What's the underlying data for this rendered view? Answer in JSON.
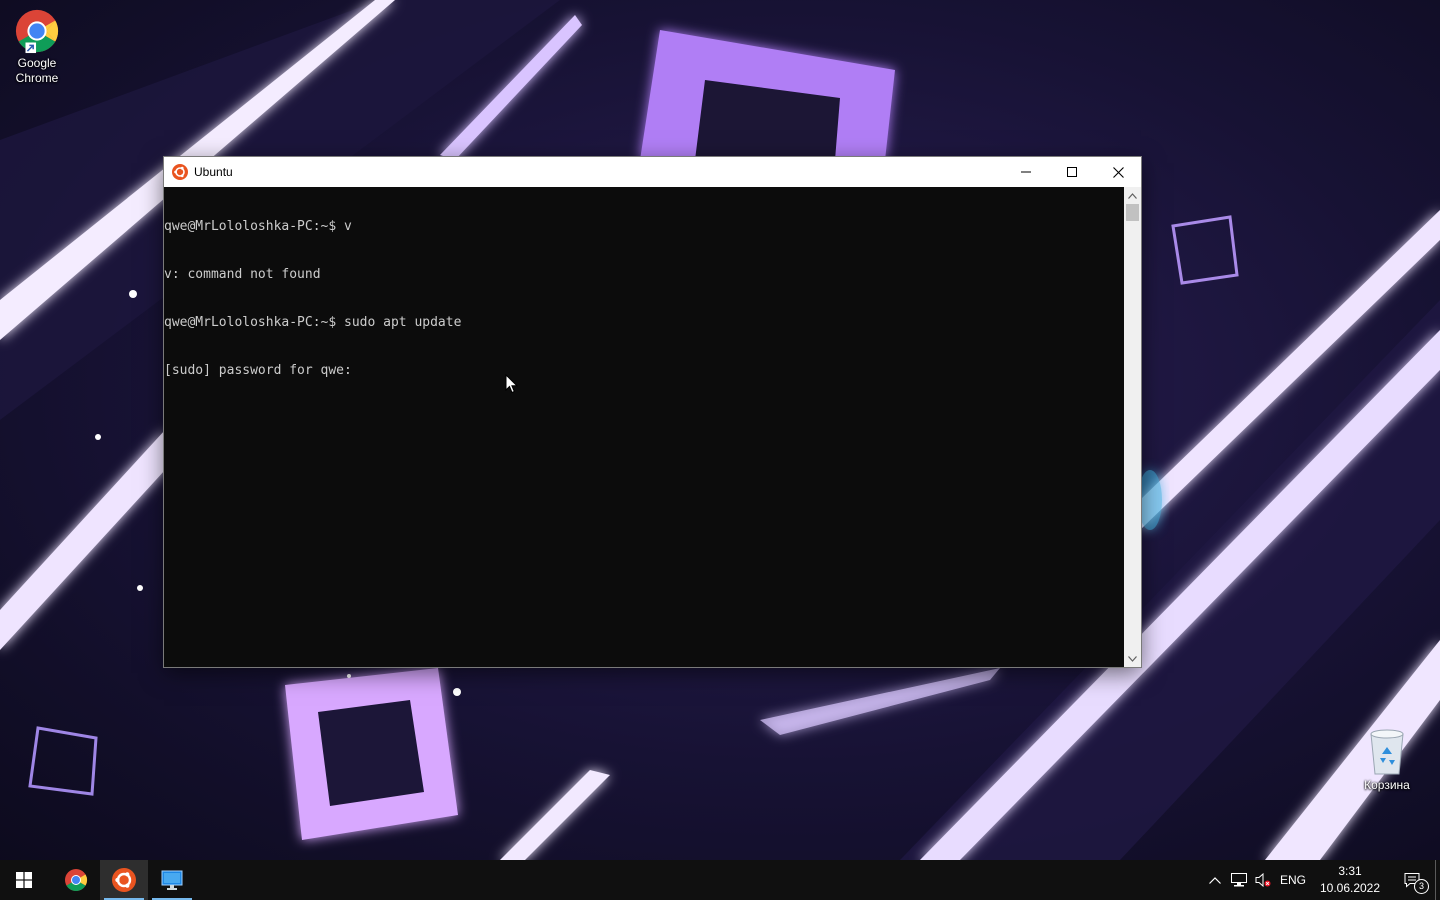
{
  "desktop": {
    "icons": [
      {
        "label": "Google Chrome",
        "icon": "chrome-icon"
      },
      {
        "label": "Корзина",
        "icon": "recycle-bin-icon"
      }
    ]
  },
  "window": {
    "title": "Ubuntu",
    "icon": "ubuntu-icon",
    "controls": [
      "minimize-icon",
      "maximize-icon",
      "close-icon"
    ],
    "console_lines": [
      "qwe@MrLololoshka-PC:~$ v",
      "v: command not found",
      "qwe@MrLololoshka-PC:~$ sudo apt update",
      "[sudo] password for qwe:"
    ],
    "background_color": "#0c0c0c",
    "text_color": "#cccccc"
  },
  "taskbar": {
    "pinned": [
      {
        "icon": "windows-start-icon",
        "active": false
      },
      {
        "icon": "chrome-icon",
        "active": false
      },
      {
        "icon": "ubuntu-icon",
        "active": true
      },
      {
        "icon": "remote-desktop-icon",
        "active": false
      }
    ],
    "tray": {
      "language": "ENG",
      "time": "3:31",
      "date": "10.06.2022",
      "notification_count": "3",
      "icons": [
        "show-hidden-icons-chevron",
        "network-icon",
        "volume-muted-icon",
        "action-center-icon"
      ]
    }
  },
  "colors": {
    "accent": "#76b9ed",
    "ubuntu_orange": "#e95420",
    "neon_purple": "#c58cff"
  }
}
